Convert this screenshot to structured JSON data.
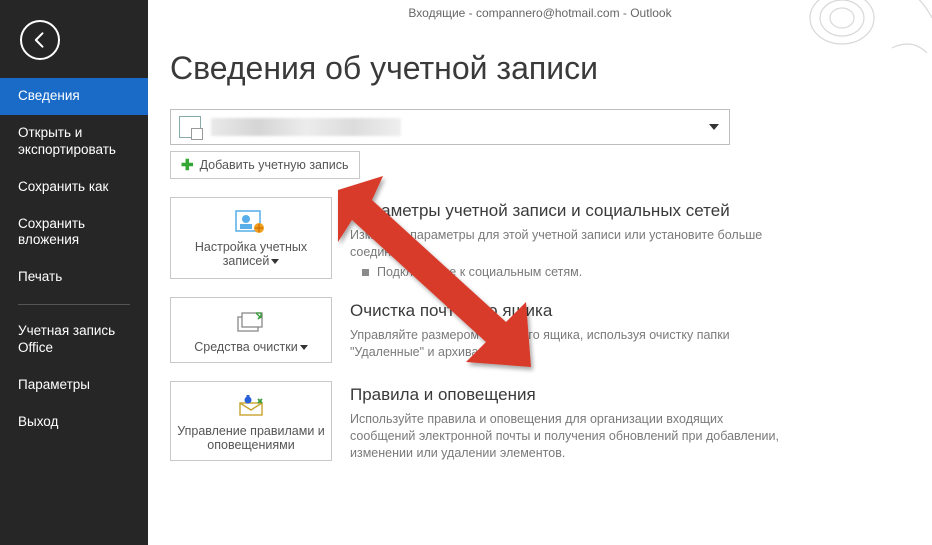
{
  "header": {
    "title": "Входящие - compannero@hotmail.com - Outlook"
  },
  "sidebar": {
    "items": [
      {
        "label": "Сведения",
        "active": true
      },
      {
        "label": "Открыть и экспортировать"
      },
      {
        "label": "Сохранить как"
      },
      {
        "label": "Сохранить вложения"
      },
      {
        "label": "Печать"
      }
    ],
    "items2": [
      {
        "label": "Учетная запись Office"
      },
      {
        "label": "Параметры"
      },
      {
        "label": "Выход"
      }
    ]
  },
  "page": {
    "title": "Сведения об учетной записи",
    "add_account": "Добавить учетную запись"
  },
  "sections": [
    {
      "tile_icon": "account-settings",
      "tile_label": "Настройка учетных записей",
      "heading": "Параметры учетной записи и социальных сетей",
      "desc": "Измените параметры для этой учетной записи или установите больше соединений.",
      "bullet": "Подключение к социальным сетям."
    },
    {
      "tile_icon": "cleanup",
      "tile_label": "Средства очистки",
      "heading": "Очистка почтового ящика",
      "desc": "Управляйте размером почтового ящика, используя очистку папки \"Удаленные\" и архивацию."
    },
    {
      "tile_icon": "rules",
      "tile_label": "Управление правилами и оповещениями",
      "heading": "Правила и оповещения",
      "desc": "Используйте правила и оповещения для организации входящих сообщений электронной почты и получения обновлений при добавлении, изменении или удалении элементов."
    }
  ]
}
